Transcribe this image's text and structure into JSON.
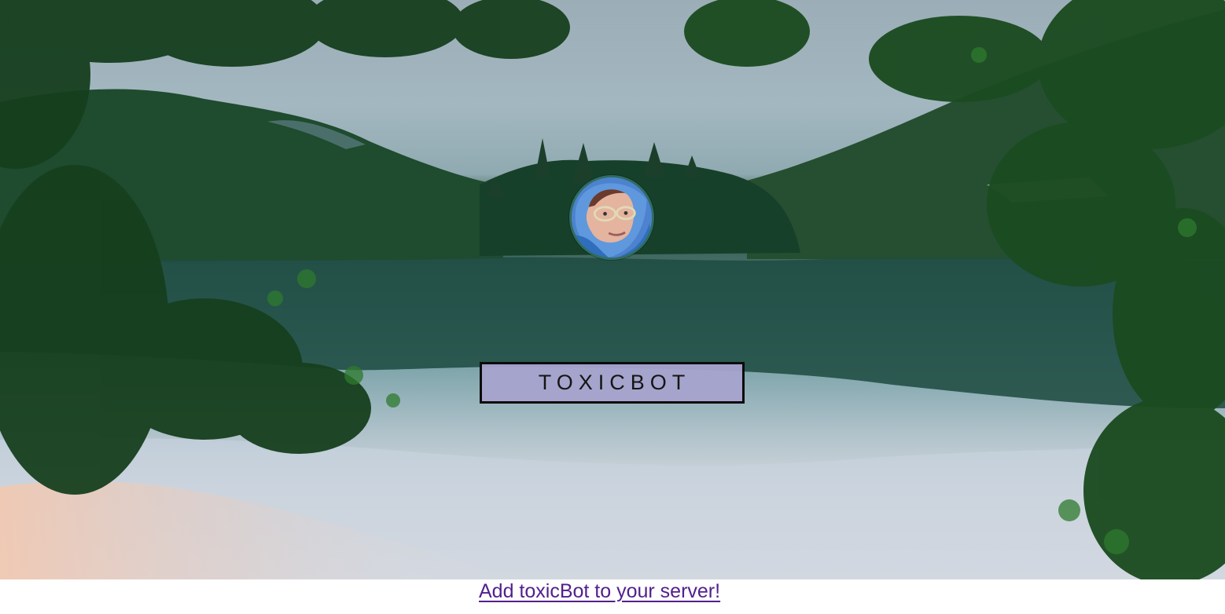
{
  "hero": {
    "image_name": "lake-forest-background",
    "title": "TOXICBOT",
    "avatar_name": "bot-avatar"
  },
  "footer": {
    "invite_link": "Add toxicBot to your server!"
  },
  "colors": {
    "link": "#52208d",
    "title_box": "#a6a3cd",
    "avatar_border": "#2f6d61"
  }
}
